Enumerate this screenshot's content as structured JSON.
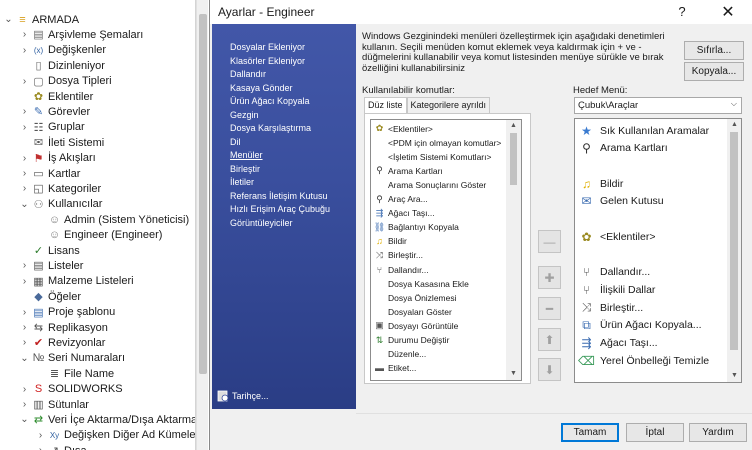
{
  "tree": {
    "items": [
      {
        "label": "ARMADA",
        "icon": "database-icon",
        "twisty": "expanded",
        "indent": 0
      },
      {
        "label": "Arşivleme Şemaları",
        "icon": "archive-icon",
        "twisty": "collapsed",
        "indent": 1
      },
      {
        "label": "Değişkenler",
        "icon": "variables-icon",
        "twisty": "collapsed",
        "indent": 1
      },
      {
        "label": "Dizinleniyor",
        "icon": "index-icon",
        "twisty": "none",
        "indent": 1
      },
      {
        "label": "Dosya Tipleri",
        "icon": "file-types-icon",
        "twisty": "collapsed",
        "indent": 1
      },
      {
        "label": "Eklentiler",
        "icon": "addins-icon",
        "twisty": "none",
        "indent": 1
      },
      {
        "label": "Görevler",
        "icon": "tasks-icon",
        "twisty": "collapsed",
        "indent": 1
      },
      {
        "label": "Gruplar",
        "icon": "groups-icon",
        "twisty": "collapsed",
        "indent": 1
      },
      {
        "label": "İleti Sistemi",
        "icon": "messaging-icon",
        "twisty": "none",
        "indent": 1
      },
      {
        "label": "İş Akışları",
        "icon": "workflow-icon",
        "twisty": "collapsed",
        "indent": 1
      },
      {
        "label": "Kartlar",
        "icon": "cards-icon",
        "twisty": "collapsed",
        "indent": 1
      },
      {
        "label": "Kategoriler",
        "icon": "categories-icon",
        "twisty": "collapsed",
        "indent": 1
      },
      {
        "label": "Kullanıcılar",
        "icon": "users-icon",
        "twisty": "expanded",
        "indent": 1
      },
      {
        "label": "Admin (Sistem Yöneticisi)",
        "icon": "user-icon",
        "twisty": "none",
        "indent": 2
      },
      {
        "label": "Engineer (Engineer)",
        "icon": "user-icon",
        "twisty": "none",
        "indent": 2
      },
      {
        "label": "Lisans",
        "icon": "license-icon",
        "twisty": "none",
        "indent": 1
      },
      {
        "label": "Listeler",
        "icon": "lists-icon",
        "twisty": "collapsed",
        "indent": 1
      },
      {
        "label": "Malzeme Listeleri",
        "icon": "bom-icon",
        "twisty": "collapsed",
        "indent": 1
      },
      {
        "label": "Öğeler",
        "icon": "items-icon",
        "twisty": "none",
        "indent": 1
      },
      {
        "label": "Proje şablonu",
        "icon": "template-icon",
        "twisty": "collapsed",
        "indent": 1
      },
      {
        "label": "Replikasyon",
        "icon": "replication-icon",
        "twisty": "collapsed",
        "indent": 1
      },
      {
        "label": "Revizyonlar",
        "icon": "revisions-icon",
        "twisty": "collapsed",
        "indent": 1
      },
      {
        "label": "Seri Numaraları",
        "icon": "serial-numbers-icon",
        "twisty": "expanded",
        "indent": 1
      },
      {
        "label": "File Name",
        "icon": "list-icon",
        "twisty": "none",
        "indent": 2
      },
      {
        "label": "SOLIDWORKS",
        "icon": "solidworks-icon",
        "twisty": "collapsed",
        "indent": 1
      },
      {
        "label": "Sütunlar",
        "icon": "columns-icon",
        "twisty": "collapsed",
        "indent": 1
      },
      {
        "label": "Veri İçe Aktarma/Dışa Aktarma",
        "icon": "import-export-icon",
        "twisty": "expanded",
        "indent": 1
      },
      {
        "label": "Değişken Diğer Ad Kümeleri",
        "icon": "alias-icon",
        "twisty": "collapsed",
        "indent": 2
      },
      {
        "label": "Dışa...",
        "icon": "export-icon",
        "twisty": "collapsed",
        "indent": 2
      }
    ]
  },
  "dialog": {
    "title": "Ayarlar - Engineer",
    "help_glyph": "?",
    "close_glyph": "✕",
    "nav_items": [
      "Dosyalar Ekleniyor",
      "Klasörler Ekleniyor",
      "Dallandır",
      "Kasaya Gönder",
      "Ürün Ağacı Kopyala",
      "Gezgin",
      "Dosya Karşılaştırma",
      "Dil",
      "Menüler",
      "Birleştir",
      "İletiler",
      "Referans İletişim Kutusu",
      "Hızlı Erişim Araç Çubuğu",
      "Görüntüleyiciler"
    ],
    "nav_selected_index": 8,
    "history_label": "Tarihçe...",
    "description": "Windows Gezginindeki menüleri özelleştirmek için aşağıdaki denetimleri kullanın. Seçili menüden komut eklemek veya kaldırmak için + ve - düğmelerini kullanabilir veya komut listesinden menüye sürükle ve bırak özelliğini kullanabilirsiniz",
    "reset_button": "Sıfırla...",
    "copy_button": "Kopyala...",
    "available_label": "Kullanılabilir komutlar:",
    "tabs": [
      "Düz liste",
      "Kategorilere ayrıldı"
    ],
    "active_tab": 0,
    "commands": [
      {
        "label": "<Eklentiler>",
        "icon": "addins-icon",
        "indent": 0
      },
      {
        "label": "<PDM için olmayan komutlar>",
        "icon": "",
        "indent": 1
      },
      {
        "label": "<İşletim Sistemi Komutları>",
        "icon": "",
        "indent": 1
      },
      {
        "label": "Arama Kartları",
        "icon": "search-icon",
        "indent": 0
      },
      {
        "label": "Arama Sonuçlarını Göster",
        "icon": "",
        "indent": 1
      },
      {
        "label": "Araç Ara...",
        "icon": "search-icon",
        "indent": 0
      },
      {
        "label": "Ağacı Taşı...",
        "icon": "tree-move-icon",
        "indent": 0
      },
      {
        "label": "Bağlantıyı Kopyala",
        "icon": "link-icon",
        "indent": 0
      },
      {
        "label": "Bildir",
        "icon": "bell-icon",
        "indent": 0
      },
      {
        "label": "Birleştir...",
        "icon": "merge-icon",
        "indent": 0
      },
      {
        "label": "Dallandır...",
        "icon": "branch-icon",
        "indent": 0
      },
      {
        "label": "Dosya Kasasına Ekle",
        "icon": "",
        "indent": 1
      },
      {
        "label": "Dosya Önizlemesi",
        "icon": "",
        "indent": 1
      },
      {
        "label": "Dosyaları Göster",
        "icon": "",
        "indent": 1
      },
      {
        "label": "Dosyayı Görüntüle",
        "icon": "view-file-icon",
        "indent": 0
      },
      {
        "label": "Durumu Değiştir",
        "icon": "change-state-icon",
        "indent": 0
      },
      {
        "label": "Düzenle...",
        "icon": "",
        "indent": 1
      },
      {
        "label": "Etiket...",
        "icon": "label-icon",
        "indent": 0
      }
    ],
    "move_buttons": [
      {
        "glyph": "—",
        "name": "separator-button"
      },
      {
        "glyph": "✚",
        "name": "add-button"
      },
      {
        "glyph": "━",
        "name": "remove-button"
      },
      {
        "glyph": "⬆",
        "name": "move-up-button"
      },
      {
        "glyph": "⬇",
        "name": "move-down-button"
      }
    ],
    "target_label": "Hedef Menü:",
    "target_value": "Çubuk\\Araçlar",
    "menu_items": [
      {
        "label": "Sık Kullanılan Aramalar",
        "icon": "star-icon"
      },
      {
        "label": "Arama Kartları",
        "icon": "search-icon"
      },
      {
        "label": "",
        "icon": ""
      },
      {
        "label": "Bildir",
        "icon": "bell-icon"
      },
      {
        "label": "Gelen Kutusu",
        "icon": "inbox-icon"
      },
      {
        "label": "",
        "icon": ""
      },
      {
        "label": "<Eklentiler>",
        "icon": "addins-icon"
      },
      {
        "label": "",
        "icon": ""
      },
      {
        "label": "Dallandır...",
        "icon": "branch-icon"
      },
      {
        "label": "İlişkili Dallar",
        "icon": "related-branches-icon"
      },
      {
        "label": "Birleştir...",
        "icon": "merge-icon"
      },
      {
        "label": "Ürün Ağacı Kopyala...",
        "icon": "copy-tree-icon"
      },
      {
        "label": "Ağacı Taşı...",
        "icon": "tree-move-icon"
      },
      {
        "label": "Yerel Önbelleği Temizle",
        "icon": "clear-cache-icon"
      }
    ],
    "ok_button": "Tamam",
    "cancel_button": "İptal",
    "help_button": "Yardım"
  }
}
